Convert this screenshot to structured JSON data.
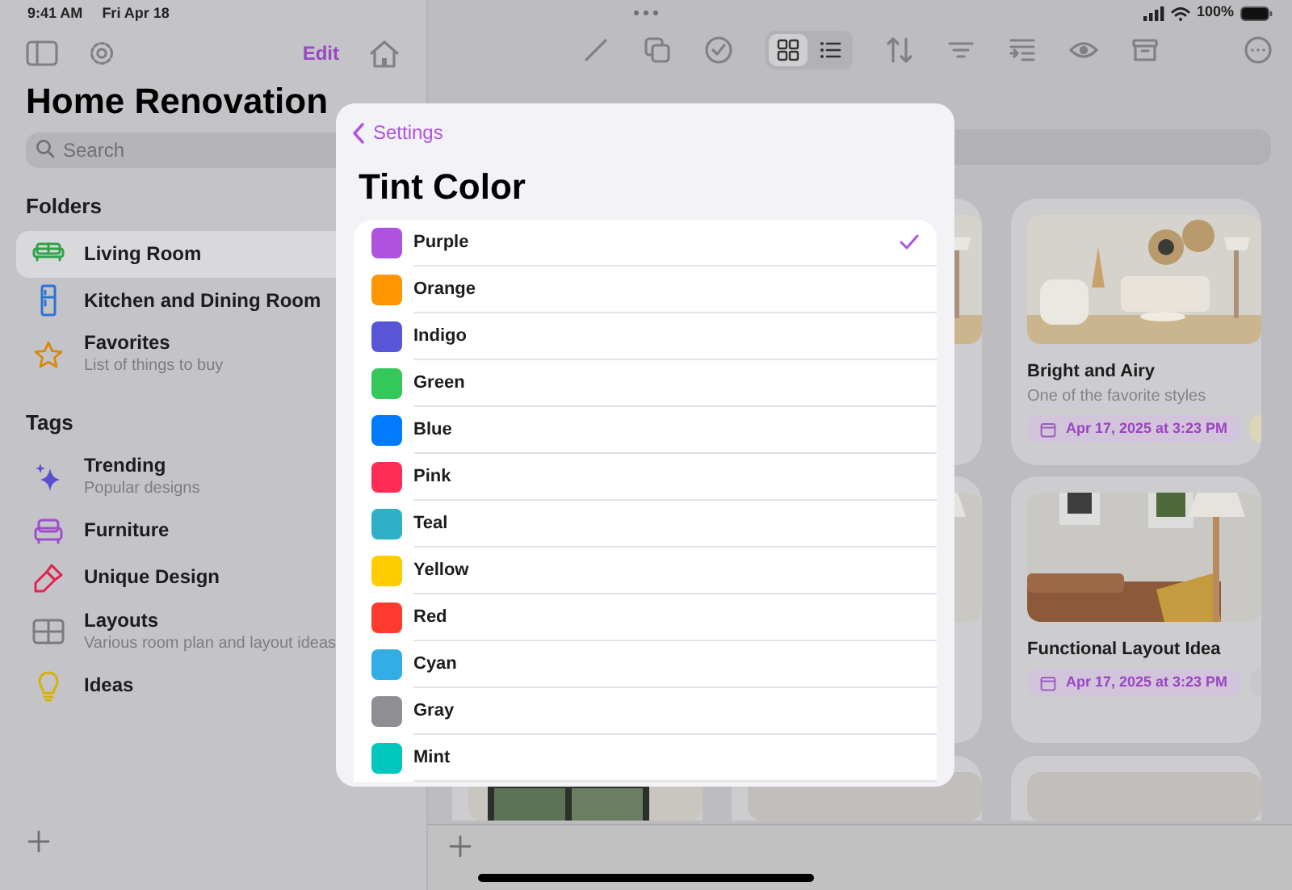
{
  "status_bar": {
    "time": "9:41 AM",
    "date": "Fri Apr 18",
    "battery": "100%"
  },
  "sidebar": {
    "edit_label": "Edit",
    "title": "Home Renovation",
    "search": {
      "placeholder": "Search"
    },
    "sections": [
      {
        "title": "Folders",
        "items": [
          {
            "kind": "sofa",
            "label": "Living Room",
            "selected": true
          },
          {
            "kind": "fridge",
            "label": "Kitchen and Dining Room",
            "selected": false
          },
          {
            "kind": "star",
            "label": "Favorites",
            "subtitle": "List of things to buy",
            "selected": false
          }
        ]
      },
      {
        "title": "Tags",
        "items": [
          {
            "kind": "sparkles",
            "label": "Trending",
            "subtitle": "Popular designs",
            "selected": false
          },
          {
            "kind": "armchair",
            "label": "Furniture",
            "selected": false
          },
          {
            "kind": "brush",
            "label": "Unique Design",
            "selected": false
          },
          {
            "kind": "grid",
            "label": "Layouts",
            "subtitle": "Various room plan and layout ideas",
            "selected": false
          },
          {
            "kind": "bulb",
            "label": "Ideas",
            "selected": false
          }
        ]
      }
    ]
  },
  "main": {
    "view_modes": [
      {
        "kind": "grid",
        "selected": true
      },
      {
        "kind": "list",
        "selected": false
      }
    ],
    "cards": [
      {
        "kind": "picture"
      },
      {
        "kind": "picture",
        "title": "Bright and Airy",
        "subtitle": "One of the favorite styles",
        "date": "Apr 17, 2025 at 3:23 PM"
      },
      {
        "kind": "picture"
      },
      {
        "kind": "picture",
        "title": "Functional Layout Idea",
        "date": "Apr 17, 2025 at 3:23 PM"
      },
      {
        "kind": "picture"
      },
      {
        "kind": "picture"
      },
      {
        "kind": "picture"
      }
    ]
  },
  "sheet": {
    "back_label": "Settings",
    "title": "Tint Color",
    "colors": [
      {
        "name": "Purple",
        "color": "#af52de",
        "selected": true
      },
      {
        "name": "Orange",
        "color": "#ff9500",
        "selected": false
      },
      {
        "name": "Indigo",
        "color": "#5856d6",
        "selected": false
      },
      {
        "name": "Green",
        "color": "#34c759",
        "selected": false
      },
      {
        "name": "Blue",
        "color": "#007aff",
        "selected": false
      },
      {
        "name": "Pink",
        "color": "#ff2d55",
        "selected": false
      },
      {
        "name": "Teal",
        "color": "#30b0c7",
        "selected": false
      },
      {
        "name": "Yellow",
        "color": "#ffcc00",
        "selected": false
      },
      {
        "name": "Red",
        "color": "#ff3b30",
        "selected": false
      },
      {
        "name": "Cyan",
        "color": "#32ade6",
        "selected": false
      },
      {
        "name": "Gray",
        "color": "#8e8e93",
        "selected": false
      },
      {
        "name": "Mint",
        "color": "#00c7be",
        "selected": false
      }
    ]
  }
}
